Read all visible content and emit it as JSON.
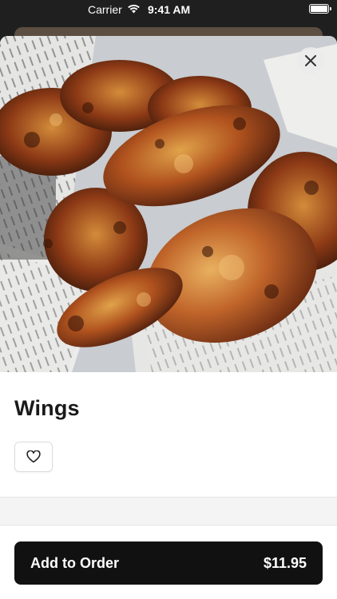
{
  "status_bar": {
    "carrier": "Carrier",
    "time": "9:41 AM"
  },
  "item": {
    "name": "Wings",
    "image_alt": "Plate of seasoned chicken wings on newspaper"
  },
  "actions": {
    "add_to_order_label": "Add to Order",
    "price": "$11.95"
  },
  "icons": {
    "close": "close-icon",
    "favorite": "heart-icon",
    "wifi": "wifi-icon",
    "battery": "battery-icon"
  },
  "colors": {
    "button_bg": "#111111",
    "sheet_bg": "#ffffff",
    "title_text": "#1a1a1a"
  }
}
